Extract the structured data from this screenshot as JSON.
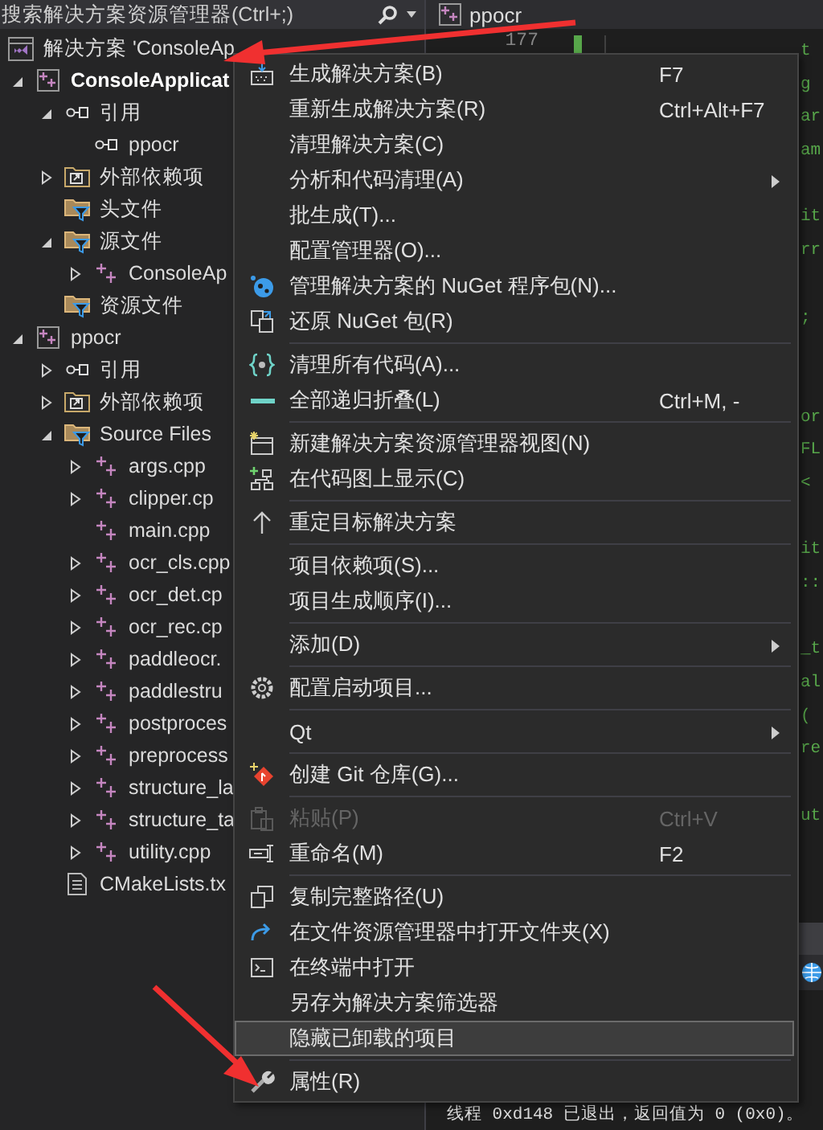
{
  "search": {
    "placeholder": "搜索解决方案资源管理器(Ctrl+;)"
  },
  "editor_tab": {
    "label": "ppocr"
  },
  "solution": {
    "label": "解决方案 'ConsoleAp",
    "children": [
      {
        "kind": "project",
        "label": "ConsoleApplicat",
        "startup": true,
        "expanded": true,
        "children": [
          {
            "kind": "references",
            "label": "引用",
            "expanded": true,
            "children": [
              {
                "kind": "reference",
                "label": "ppocr"
              }
            ]
          },
          {
            "kind": "external",
            "label": "外部依赖项",
            "expanded": false
          },
          {
            "kind": "filter",
            "label": "头文件"
          },
          {
            "kind": "filter",
            "label": "源文件",
            "expanded": true,
            "children": [
              {
                "kind": "cpp",
                "label": "ConsoleAp",
                "expanded": false
              }
            ]
          },
          {
            "kind": "filter",
            "label": "资源文件"
          }
        ]
      },
      {
        "kind": "project",
        "label": "ppocr",
        "startup": false,
        "expanded": true,
        "children": [
          {
            "kind": "references",
            "label": "引用",
            "expanded": false
          },
          {
            "kind": "external",
            "label": "外部依赖项",
            "expanded": false
          },
          {
            "kind": "filter",
            "label": "Source Files",
            "expanded": true,
            "children": [
              {
                "kind": "cpp",
                "label": "args.cpp",
                "expanded": false
              },
              {
                "kind": "cpp",
                "label": "clipper.cp",
                "expanded": false
              },
              {
                "kind": "cpp",
                "label": "main.cpp"
              },
              {
                "kind": "cpp",
                "label": "ocr_cls.cpp",
                "expanded": false
              },
              {
                "kind": "cpp",
                "label": "ocr_det.cp",
                "expanded": false
              },
              {
                "kind": "cpp",
                "label": "ocr_rec.cp",
                "expanded": false
              },
              {
                "kind": "cpp",
                "label": "paddleocr.",
                "expanded": false
              },
              {
                "kind": "cpp",
                "label": "paddlestru",
                "expanded": false
              },
              {
                "kind": "cpp",
                "label": "postproces",
                "expanded": false
              },
              {
                "kind": "cpp",
                "label": "preprocess",
                "expanded": false
              },
              {
                "kind": "cpp",
                "label": "structure_la",
                "expanded": false
              },
              {
                "kind": "cpp",
                "label": "structure_ta",
                "expanded": false
              },
              {
                "kind": "cpp",
                "label": "utility.cpp",
                "expanded": false
              }
            ]
          },
          {
            "kind": "file",
            "label": "CMakeLists.tx"
          }
        ]
      }
    ]
  },
  "editor": {
    "line_numbers": [
      "177"
    ],
    "code_blocks": [
      [
        "t",
        "g",
        "ar",
        "am"
      ],
      [
        "it",
        "rr"
      ],
      [
        ";"
      ],
      [
        "or",
        "FL",
        "<"
      ],
      [
        "it",
        "::"
      ],
      [
        "_t",
        "al",
        "(",
        "re"
      ],
      [
        "ut"
      ]
    ]
  },
  "output": {
    "text": "线程 0xd148 已退出，返回值为 0 (0x0)。"
  },
  "context_menu": {
    "items": [
      {
        "kind": "item",
        "label": "生成解决方案(B)",
        "shortcut": "F7",
        "submenu": false,
        "disabled": false,
        "selected": false
      },
      {
        "kind": "item",
        "label": "重新生成解决方案(R)",
        "shortcut": "Ctrl+Alt+F7",
        "submenu": false,
        "disabled": false,
        "selected": false
      },
      {
        "kind": "item",
        "label": "清理解决方案(C)",
        "submenu": false,
        "disabled": false,
        "selected": false
      },
      {
        "kind": "item",
        "label": "分析和代码清理(A)",
        "submenu": true,
        "disabled": false,
        "selected": false
      },
      {
        "kind": "item",
        "label": "批生成(T)...",
        "submenu": false,
        "disabled": false,
        "selected": false
      },
      {
        "kind": "item",
        "label": "配置管理器(O)...",
        "submenu": false,
        "disabled": false,
        "selected": false
      },
      {
        "kind": "item",
        "label": "管理解决方案的 NuGet 程序包(N)...",
        "submenu": false,
        "disabled": false,
        "selected": false
      },
      {
        "kind": "item",
        "label": "还原 NuGet 包(R)",
        "submenu": false,
        "disabled": false,
        "selected": false
      },
      {
        "kind": "separator"
      },
      {
        "kind": "item",
        "label": "清理所有代码(A)...",
        "submenu": false,
        "disabled": false,
        "selected": false
      },
      {
        "kind": "item",
        "label": "全部递归折叠(L)",
        "shortcut": "Ctrl+M, -",
        "submenu": false,
        "disabled": false,
        "selected": false
      },
      {
        "kind": "separator"
      },
      {
        "kind": "item",
        "label": "新建解决方案资源管理器视图(N)",
        "submenu": false,
        "disabled": false,
        "selected": false
      },
      {
        "kind": "item",
        "label": "在代码图上显示(C)",
        "submenu": false,
        "disabled": false,
        "selected": false
      },
      {
        "kind": "separator"
      },
      {
        "kind": "item",
        "label": "重定目标解决方案",
        "submenu": false,
        "disabled": false,
        "selected": false
      },
      {
        "kind": "separator"
      },
      {
        "kind": "item",
        "label": "项目依赖项(S)...",
        "submenu": false,
        "disabled": false,
        "selected": false
      },
      {
        "kind": "item",
        "label": "项目生成顺序(I)...",
        "submenu": false,
        "disabled": false,
        "selected": false
      },
      {
        "kind": "separator"
      },
      {
        "kind": "item",
        "label": "添加(D)",
        "submenu": true,
        "disabled": false,
        "selected": false
      },
      {
        "kind": "separator"
      },
      {
        "kind": "item",
        "label": "配置启动项目...",
        "submenu": false,
        "disabled": false,
        "selected": false
      },
      {
        "kind": "separator"
      },
      {
        "kind": "item",
        "label": "Qt",
        "submenu": true,
        "disabled": false,
        "selected": false
      },
      {
        "kind": "separator"
      },
      {
        "kind": "item",
        "label": "创建 Git 仓库(G)...",
        "submenu": false,
        "disabled": false,
        "selected": false
      },
      {
        "kind": "separator"
      },
      {
        "kind": "item",
        "label": "粘贴(P)",
        "shortcut": "Ctrl+V",
        "submenu": false,
        "disabled": true,
        "selected": false
      },
      {
        "kind": "item",
        "label": "重命名(M)",
        "shortcut": "F2",
        "submenu": false,
        "disabled": false,
        "selected": false
      },
      {
        "kind": "separator"
      },
      {
        "kind": "item",
        "label": "复制完整路径(U)",
        "submenu": false,
        "disabled": false,
        "selected": false
      },
      {
        "kind": "item",
        "label": "在文件资源管理器中打开文件夹(X)",
        "submenu": false,
        "disabled": false,
        "selected": false
      },
      {
        "kind": "item",
        "label": "在终端中打开",
        "submenu": false,
        "disabled": false,
        "selected": false
      },
      {
        "kind": "item",
        "label": "另存为解决方案筛选器",
        "submenu": false,
        "disabled": false,
        "selected": false
      },
      {
        "kind": "item",
        "label": "隐藏已卸载的项目",
        "submenu": false,
        "disabled": false,
        "selected": true
      },
      {
        "kind": "separator"
      },
      {
        "kind": "item",
        "label": "属性(R)",
        "submenu": false,
        "disabled": false,
        "selected": false
      }
    ]
  }
}
